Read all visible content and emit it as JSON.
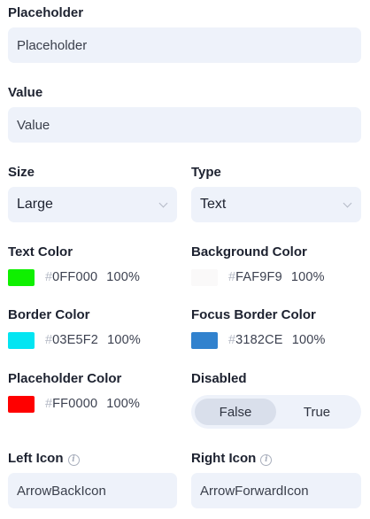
{
  "placeholder": {
    "label": "Placeholder",
    "value": "Placeholder"
  },
  "value": {
    "label": "Value",
    "value": "Value"
  },
  "size": {
    "label": "Size",
    "selected": "Large"
  },
  "type": {
    "label": "Type",
    "selected": "Text"
  },
  "text_color": {
    "label": "Text Color",
    "hash": "#",
    "hex": "0FF000",
    "opacity": "100%",
    "swatch": "#0ff000"
  },
  "background_color": {
    "label": "Background Color",
    "hash": "#",
    "hex": "FAF9F9",
    "opacity": "100%",
    "swatch": "#faf9f9"
  },
  "border_color": {
    "label": "Border Color",
    "hash": "#",
    "hex": "03E5F2",
    "opacity": "100%",
    "swatch": "#03e5f2"
  },
  "focus_border_color": {
    "label": "Focus Border Color",
    "hash": "#",
    "hex": "3182CE",
    "opacity": "100%",
    "swatch": "#3182ce"
  },
  "placeholder_color": {
    "label": "Placeholder Color",
    "hash": "#",
    "hex": "FF0000",
    "opacity": "100%",
    "swatch": "#ff0000"
  },
  "disabled": {
    "label": "Disabled",
    "options": [
      "False",
      "True"
    ],
    "selected": "False"
  },
  "left_icon": {
    "label": "Left Icon",
    "value": "ArrowBackIcon",
    "info_icon": "info-icon"
  },
  "right_icon": {
    "label": "Right Icon",
    "value": "ArrowForwardIcon",
    "info_icon": "info-icon"
  }
}
